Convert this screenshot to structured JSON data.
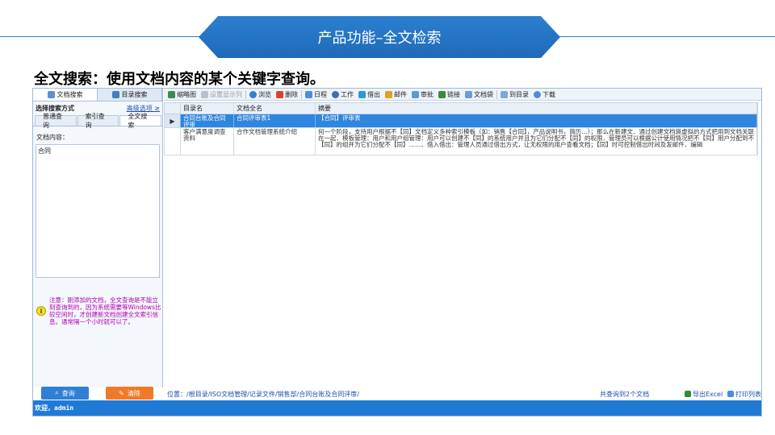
{
  "slide": {
    "title": "产品功能–全文检索",
    "subtitle": "全文搜索：使用文档内容的某个关键字查询。"
  },
  "left_panel": {
    "top_tabs": [
      "文档搜索",
      "目录搜索"
    ],
    "search_mode_label": "选择搜索方式",
    "advanced_link": "高级选项 ≥",
    "sub_tabs": [
      "普通查询",
      "索引查询",
      "全文搜索"
    ],
    "content_label": "文档内容：",
    "content_value": "合同",
    "note": "注意：刚添加的文档，全文查询是不能立刻查询到的，因为系统需要等Windows比较空闲时，才创建新文档创建全文索引信息。通常隔一个小时就可以了。",
    "query_button": "查询",
    "clear_button": "清除"
  },
  "toolbar": {
    "items": [
      "缩略图",
      "设置显示列",
      "浏览",
      "删除",
      "日程",
      "工作",
      "借出",
      "邮件",
      "审批",
      "链接",
      "文档袋",
      "到目录",
      "下载"
    ]
  },
  "grid": {
    "columns": [
      "",
      "目录名",
      "文档全名",
      "摘要"
    ],
    "rows": [
      {
        "marker": "▶",
        "dir": "合同台账及合同评审",
        "name": "合同评审表1",
        "summary": "【合同】评审表"
      },
      {
        "marker": "",
        "dir": "客户满意度调查资料",
        "name": "合作文档管理系统介绍",
        "summary": "何一个阶段，支持用户根据不【同】文档定义多种索引模板（如：销售【合同】，产品说明书，简历…）；那么在新建文．通过创建文档袋虚拟的方式把用到文档关联在一起．模板管理：用户和用户组管理：用户可以创建不【同】的系统用户并且为它们分配不【同】的权限．管理员可以根据公计使用情况把不【同】用户分配到不【同】的组并为它们分配不【同】……、借入借出：管理人员通过借出方式，让无权限的用户查看文档；【同】时可控制借出时间及发邮件、编辑"
      }
    ]
  },
  "status": {
    "path": "位置：/根目录/ISO文档管理/记录文件/销售部/合同台账及合同评审/",
    "count": "共查询到2个文档",
    "export": "导出Excel",
    "print": "打印列表",
    "welcome": "欢迎，admin"
  },
  "colors": {
    "accent": "#1f7ad6",
    "title_band": "#2b7fd0",
    "selected_row": "#2e86de",
    "clear_button": "#f07a28",
    "note_text": "#b000b0"
  }
}
